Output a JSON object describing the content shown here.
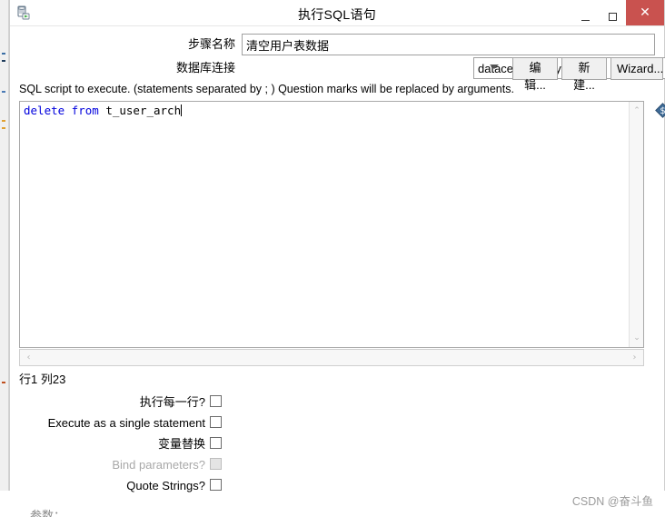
{
  "window": {
    "title": "执行SQL语句",
    "icon": "sql-execute-icon",
    "controls": {
      "minimize_label": "—",
      "maximize_label": "□",
      "close_label": "✕",
      "close_color": "#c9524f"
    }
  },
  "form": {
    "step_name": {
      "label": "步骤名称",
      "value": "清空用户表数据",
      "placeholder": ""
    },
    "db_connection": {
      "label": "数据库连接",
      "value": "datacenter_hwy",
      "options": [
        "datacenter_hwy"
      ]
    },
    "buttons": {
      "edit": "编辑...",
      "new": "新建...",
      "wizard": "Wizard..."
    }
  },
  "editor": {
    "hint": "SQL script to execute. (statements separated by ; ) Question marks will be replaced by arguments.",
    "sql_keyword": "delete from",
    "sql_body": " t_user_arch",
    "keyword_color": "#0000dd",
    "scroll_up_glyph": "⌃",
    "scroll_down_glyph": "⌄",
    "scroll_left_glyph": "‹",
    "scroll_right_glyph": "›",
    "variable_icon": "variable-diamond-icon",
    "caret_status": "行1 列23"
  },
  "options": [
    {
      "label": "执行每一行?",
      "checked": false,
      "disabled": false,
      "name": "execute-each-row"
    },
    {
      "label": "Execute as a single statement",
      "checked": false,
      "disabled": false,
      "name": "execute-single-statement"
    },
    {
      "label": "变量替换",
      "checked": false,
      "disabled": false,
      "name": "variable-substitution"
    },
    {
      "label": "Bind parameters?",
      "checked": false,
      "disabled": true,
      "name": "bind-parameters"
    },
    {
      "label": "Quote Strings?",
      "checked": false,
      "disabled": false,
      "name": "quote-strings"
    }
  ],
  "footer": {
    "clipped_label": "参数：",
    "watermark": "CSDN @奋斗鱼"
  }
}
